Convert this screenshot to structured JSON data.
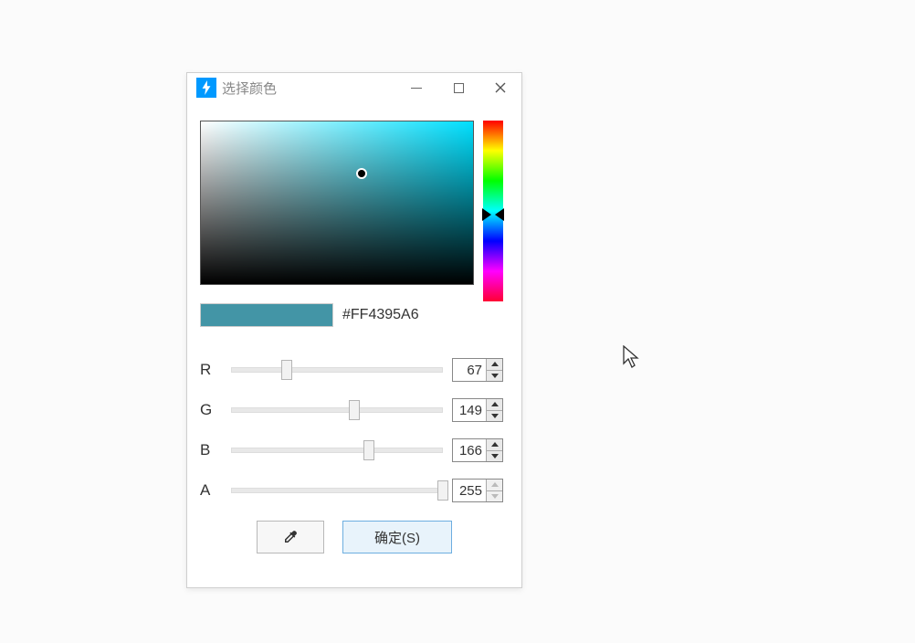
{
  "dialog": {
    "title": "选择颜色",
    "swatch_hex": "#FF4395A6",
    "swatch_color": "#4395A6"
  },
  "channels": {
    "r": {
      "label": "R",
      "value": "67",
      "max": 255
    },
    "g": {
      "label": "G",
      "value": "149",
      "max": 255
    },
    "b": {
      "label": "B",
      "value": "166",
      "max": 255
    },
    "a": {
      "label": "A",
      "value": "255",
      "max": 255
    }
  },
  "buttons": {
    "ok": "确定(S)"
  }
}
